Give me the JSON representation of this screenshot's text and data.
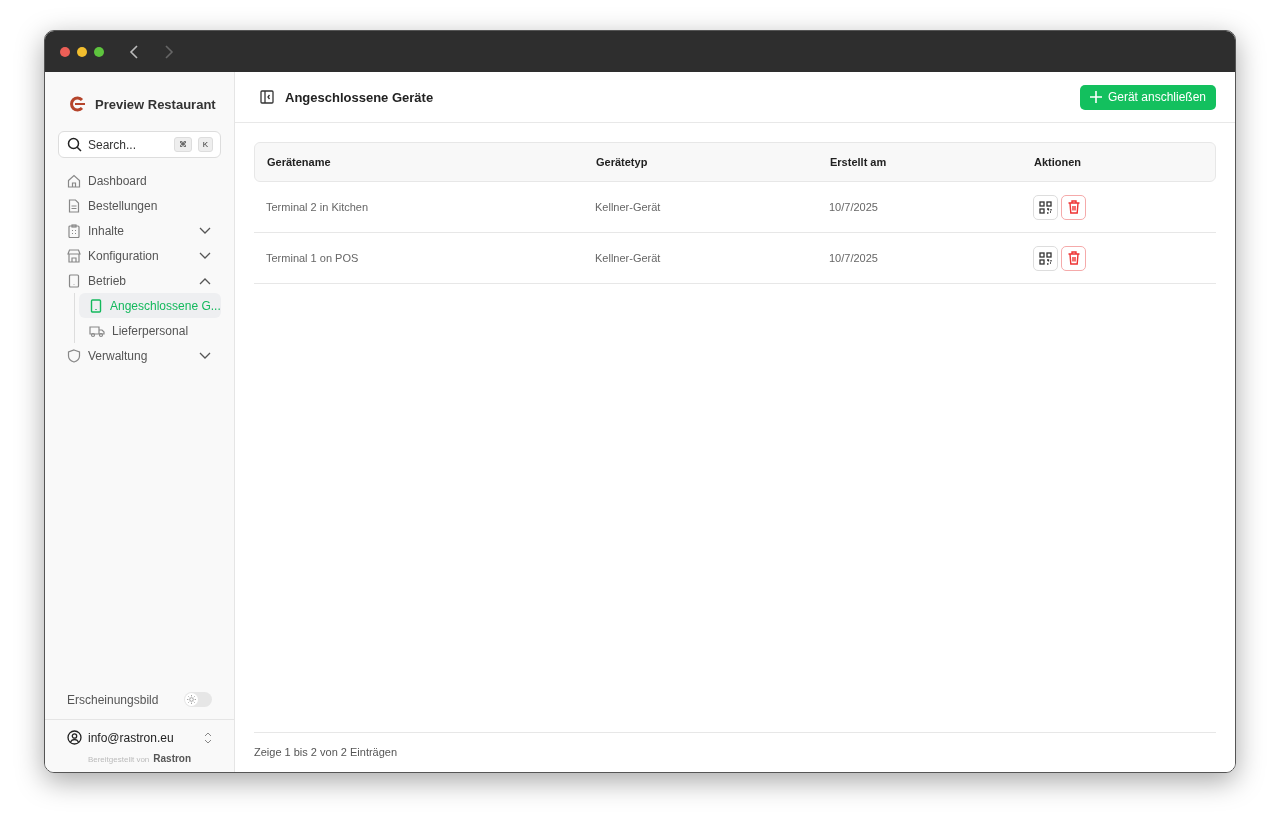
{
  "sidebar": {
    "brand": "Preview Restaurant",
    "search": {
      "placeholder": "Search...",
      "keys": [
        "⌘",
        "K"
      ]
    },
    "items": [
      {
        "label": "Dashboard",
        "selected": false
      },
      {
        "label": "Bestellungen",
        "selected": false
      },
      {
        "label": "Inhalte",
        "selected": false,
        "expanded": false
      },
      {
        "label": "Konfiguration",
        "selected": false,
        "expanded": false
      },
      {
        "label": "Betrieb",
        "selected": false,
        "expanded": true,
        "children": [
          {
            "label": "Angeschlossene G...",
            "selected": true
          },
          {
            "label": "Lieferpersonal",
            "selected": false
          }
        ]
      },
      {
        "label": "Verwaltung",
        "selected": false,
        "expanded": false
      }
    ],
    "appearance": {
      "label": "Erscheinungsbild",
      "on": false
    },
    "account": "info@rastron.eu",
    "powered_by": "Bereitgestellt von",
    "powered_logo": "Rastron"
  },
  "header": {
    "title": "Angeschlossene Geräte",
    "button": "Gerät anschließen"
  },
  "table": {
    "columns": [
      "Gerätename",
      "Gerätetyp",
      "Erstellt am",
      "Aktionen"
    ],
    "rows": [
      {
        "cells": [
          "Terminal 2 in Kitchen",
          "Kellner-Gerät",
          "10/7/2025"
        ]
      },
      {
        "cells": [
          "Terminal 1 on POS",
          "Kellner-Gerät",
          "10/7/2025"
        ]
      }
    ]
  },
  "status": "Zeige 1 bis 2 von 2 Einträgen"
}
